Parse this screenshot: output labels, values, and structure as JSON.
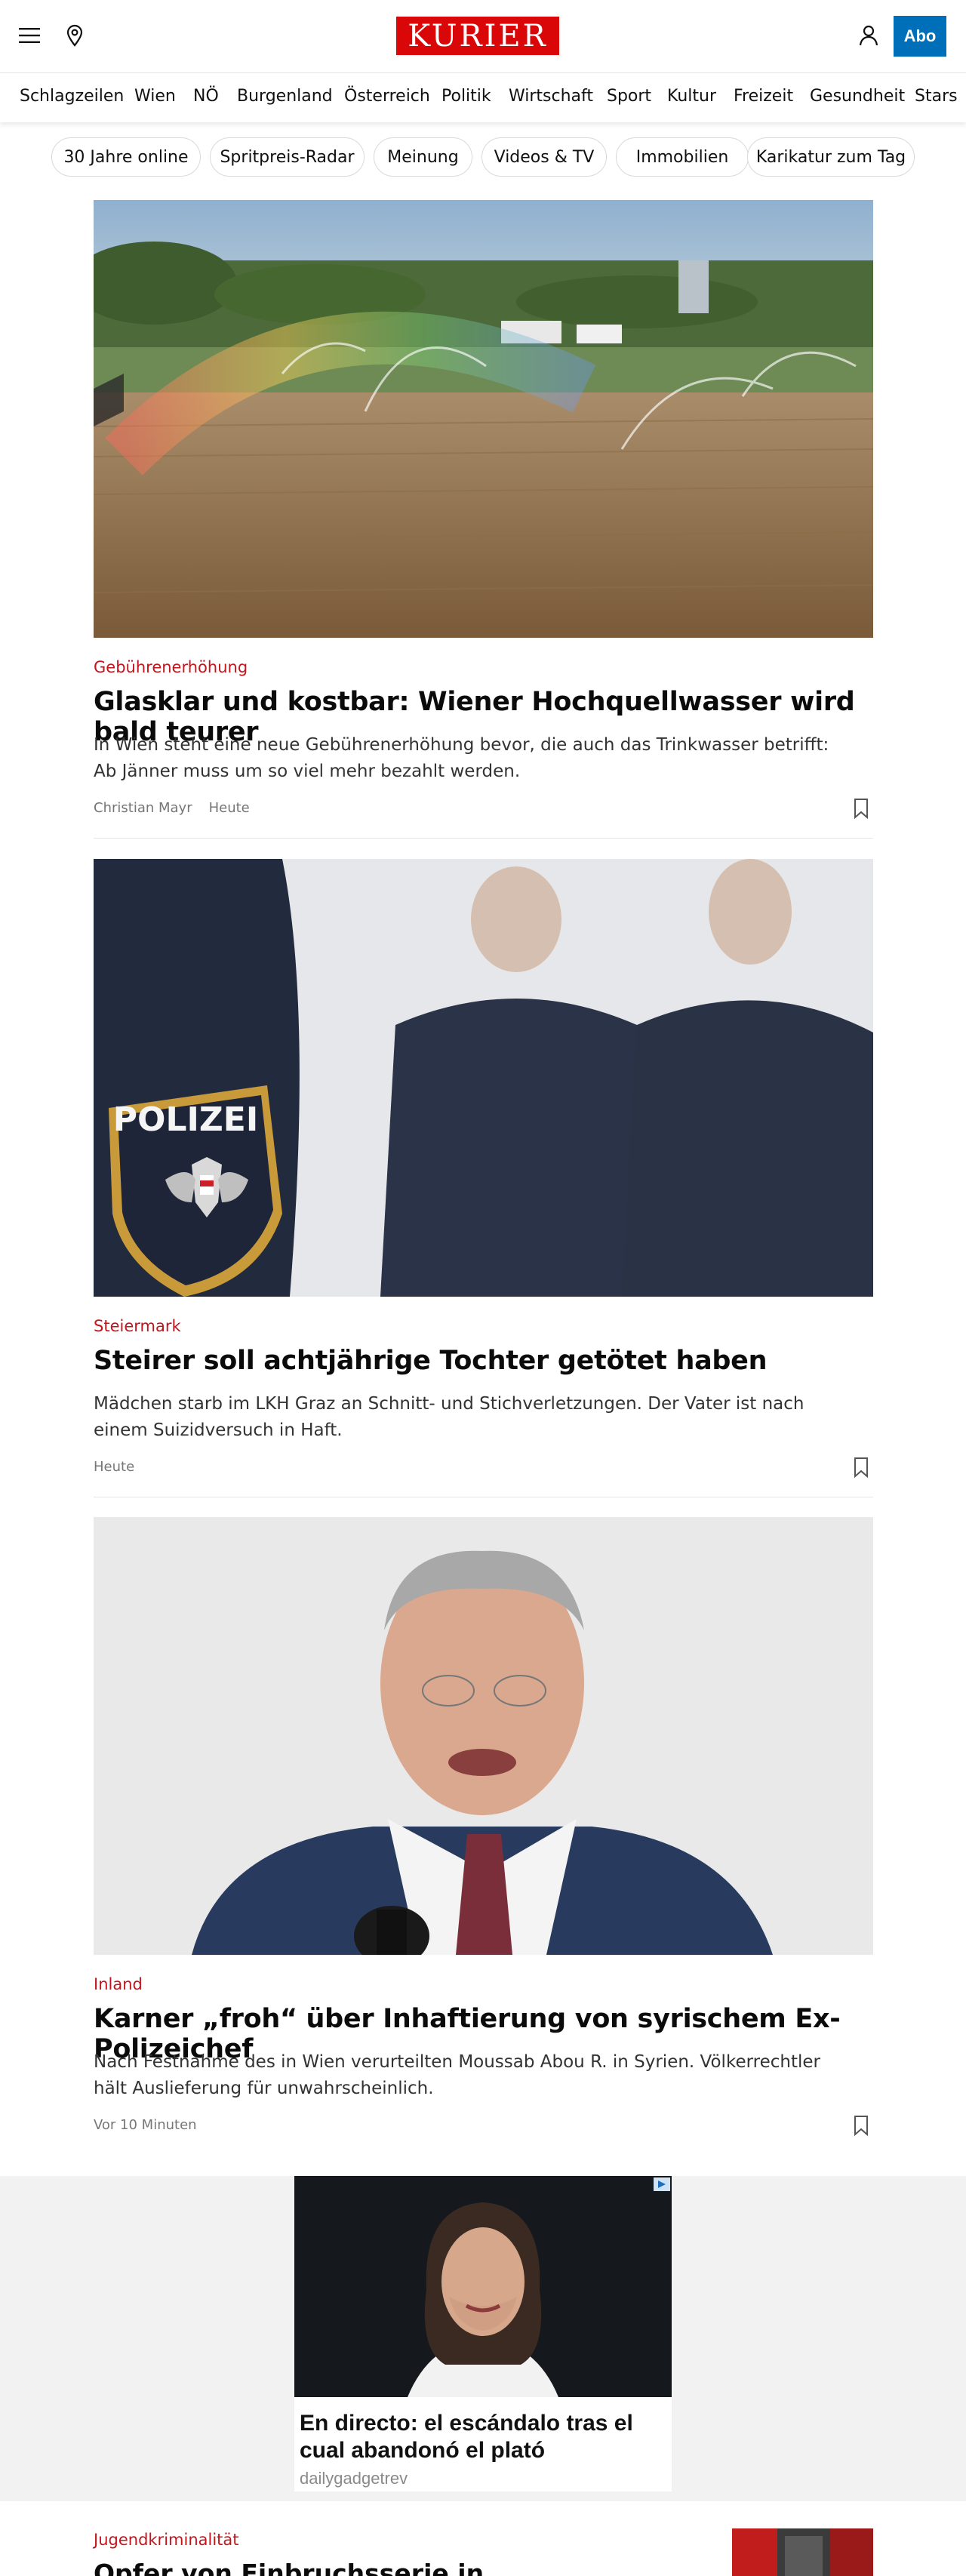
{
  "header": {
    "menu_icon": "hamburger-menu-icon",
    "location_icon": "map-pin-icon",
    "logo_text": "KURIER",
    "user_icon": "user-icon",
    "abo_label": "Abo",
    "brand_color": "#d90707",
    "abo_color": "#006fba"
  },
  "nav": {
    "items": [
      "Schlagzeilen",
      "Wien",
      "NÖ",
      "Burgenland",
      "Österreich",
      "Politik",
      "Wirtschaft",
      "Sport",
      "Kultur",
      "Freizeit",
      "Gesundheit",
      "Stars"
    ]
  },
  "pills": [
    "30 Jahre online",
    "Spritpreis-Radar",
    "Meinung",
    "Videos & TV",
    "Immobilien",
    "Karikatur zum Tag"
  ],
  "articles": [
    {
      "kicker": "Gebührenerhöhung",
      "title": "Glasklar und kostbar: Wiener Hochquellwasser wird bald teurer",
      "teaser": "In Wien steht eine neue Gebührenerhöhung bevor, die auch das Trinkwasser betrifft: Ab Jänner muss um so viel mehr bezahlt werden.",
      "author": "Christian Mayr",
      "time": "Heute"
    },
    {
      "kicker": "Steiermark",
      "title": "Steirer soll achtjährige Tochter getötet haben",
      "teaser": "Mädchen starb im LKH Graz an Schnitt- und Stichverletzungen. Der Vater ist nach einem Suizidversuch in Haft.",
      "author": "",
      "time": "Heute",
      "patch_text": "POLIZEI"
    },
    {
      "kicker": "Inland",
      "title": "Karner „froh“ über Inhaftierung von syrischem Ex-Polizeichef",
      "teaser": "Nach Festnahme des in Wien verurteilten Moussab Abou R. in Syrien. Völkerrechtler hält Auslieferung für unwahrscheinlich.",
      "author": "",
      "time": "Vor 10 Minuten"
    }
  ],
  "ad": {
    "title": "En directo: el escándalo tras el cual abandonó el plató",
    "source": "dailygadgetrev"
  },
  "next_article": {
    "kicker": "Jugendkriminalität",
    "title": "Opfer von Einbruchsserie in"
  }
}
